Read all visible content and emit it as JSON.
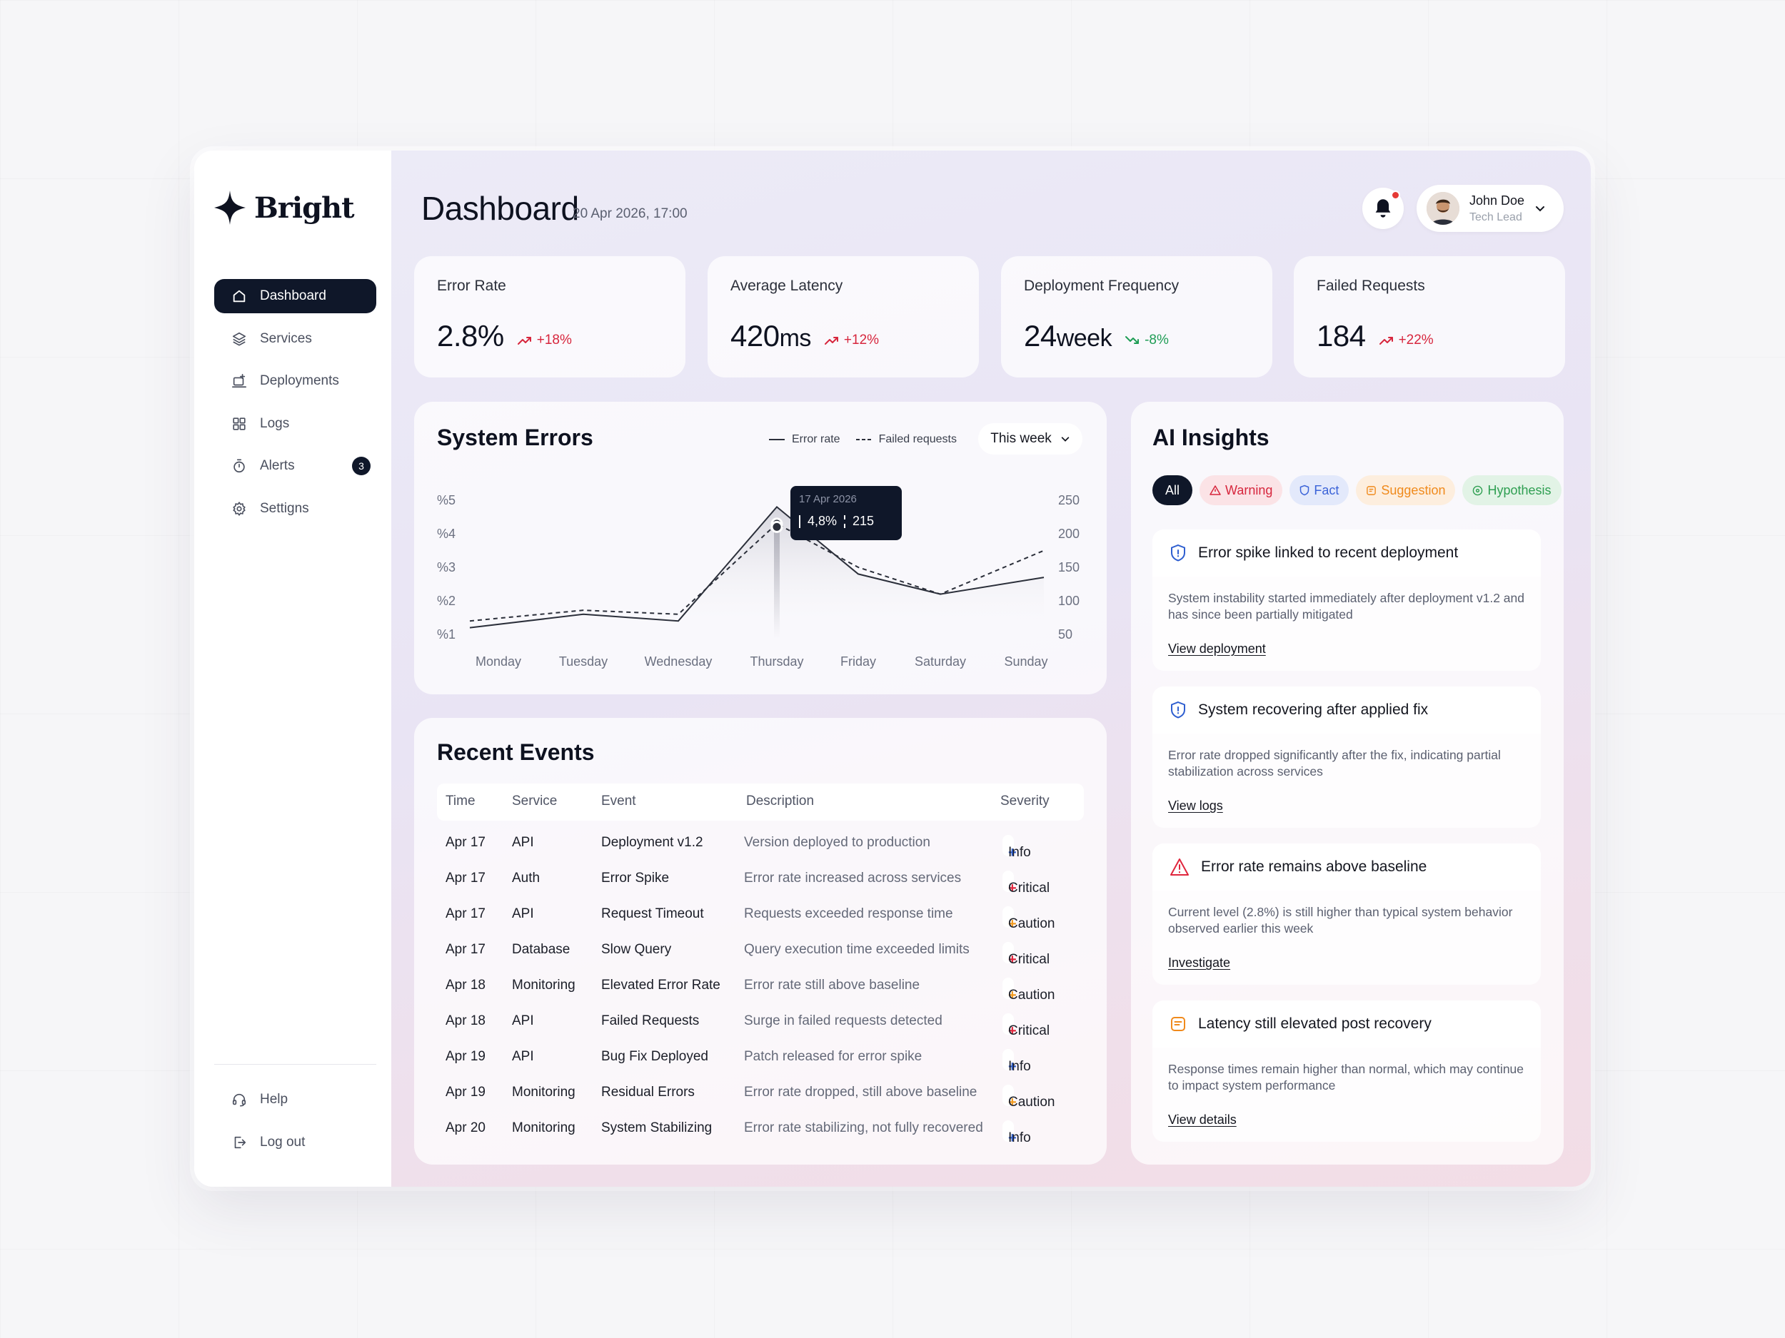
{
  "brand": {
    "name": "Bright"
  },
  "sidebar": {
    "items": [
      {
        "label": "Dashboard",
        "icon": "home-icon",
        "active": true
      },
      {
        "label": "Services",
        "icon": "layers-icon"
      },
      {
        "label": "Deployments",
        "icon": "deploy-icon"
      },
      {
        "label": "Logs",
        "icon": "grid-icon"
      },
      {
        "label": "Alerts",
        "icon": "timer-icon",
        "badge": "3"
      },
      {
        "label": "Settigns",
        "icon": "gear-icon"
      }
    ],
    "bottom": [
      {
        "label": "Help",
        "icon": "headset-icon"
      },
      {
        "label": "Log out",
        "icon": "logout-icon"
      }
    ]
  },
  "header": {
    "title": "Dashboard",
    "date": "20 Apr 2026, 17:00",
    "user": {
      "name": "John Doe",
      "role": "Tech Lead"
    }
  },
  "kpis": [
    {
      "label": "Error Rate",
      "value": "2.8%",
      "unit": "",
      "delta": "+18%",
      "trend": "up"
    },
    {
      "label": "Average Latency",
      "value": "420",
      "unit": "ms",
      "delta": "+12%",
      "trend": "up"
    },
    {
      "label": "Deployment Frequency",
      "value": "24",
      "unit": "week",
      "delta": "-8%",
      "trend": "down"
    },
    {
      "label": "Failed Requests",
      "value": "184",
      "unit": "",
      "delta": "+22%",
      "trend": "up"
    }
  ],
  "system_errors": {
    "title": "System Errors",
    "legend": [
      "Error rate",
      "Failed requests"
    ],
    "range_select": "This week",
    "tooltip": {
      "date": "17 Apr 2026",
      "rate": "4,8%",
      "requests": "215"
    }
  },
  "chart_data": {
    "type": "line",
    "categories": [
      "Monday",
      "Tuesday",
      "Wednesday",
      "Thursday",
      "Friday",
      "Saturday",
      "Sunday"
    ],
    "series": [
      {
        "name": "Error rate",
        "axis": "left",
        "style": "solid",
        "values": [
          1.2,
          1.6,
          1.4,
          4.8,
          2.8,
          2.2,
          2.7
        ]
      },
      {
        "name": "Failed requests",
        "axis": "right",
        "style": "dashed",
        "values": [
          70,
          86,
          80,
          215,
          150,
          110,
          175
        ]
      }
    ],
    "y_left": {
      "ticks": [
        "%5",
        "%4",
        "%3",
        "%2",
        "%1"
      ],
      "range": [
        1,
        5
      ]
    },
    "y_right": {
      "ticks": [
        "250",
        "200",
        "150",
        "100",
        "50"
      ],
      "range": [
        50,
        250
      ]
    },
    "highlight_index": 3
  },
  "events": {
    "title": "Recent Events",
    "columns": [
      "Time",
      "Service",
      "Event",
      "Description",
      "Severity"
    ],
    "rows": [
      [
        "Apr 17",
        "API",
        "Deployment v1.2",
        "Version deployed to production",
        "Info"
      ],
      [
        "Apr 17",
        "Auth",
        "Error Spike",
        "Error rate increased across services",
        "Critical"
      ],
      [
        "Apr 17",
        "API",
        "Request Timeout",
        "Requests exceeded response time",
        "Caution"
      ],
      [
        "Apr 17",
        "Database",
        "Slow Query",
        "Query execution time exceeded limits",
        "Critical"
      ],
      [
        "Apr 18",
        "Monitoring",
        "Elevated Error Rate",
        "Error rate still above baseline",
        "Caution"
      ],
      [
        "Apr 18",
        "API",
        "Failed Requests",
        "Surge in failed requests detected",
        "Critical"
      ],
      [
        "Apr 19",
        "API",
        "Bug Fix Deployed",
        "Patch released for error spike",
        "Info"
      ],
      [
        "Apr 19",
        "Monitoring",
        "Residual Errors",
        "Error rate dropped, still above baseline",
        "Caution"
      ],
      [
        "Apr 20",
        "Monitoring",
        "System Stabilizing",
        "Error rate stabilizing, not fully recovered",
        "Info"
      ]
    ],
    "severity_colors": {
      "Info": "#2f5fd0",
      "Critical": "#e0263d",
      "Caution": "#f29a1f"
    }
  },
  "insights": {
    "title": "AI Insights",
    "filters": [
      "All",
      "Warning",
      "Fact",
      "Suggestion",
      "Hypothesis"
    ],
    "items": [
      {
        "type": "fact",
        "icon": "shield-icon",
        "title": "Error spike linked to recent deployment",
        "body": "System instability started immediately after deployment v1.2 and has since been partially mitigated",
        "link": "View deployment"
      },
      {
        "type": "fact",
        "icon": "shield-icon",
        "title": "System recovering after applied fix",
        "body": "Error rate dropped significantly after the fix, indicating partial stabilization across services",
        "link": "View logs"
      },
      {
        "type": "warning",
        "icon": "warning-icon",
        "title": "Error rate remains above baseline",
        "body": "Current level (2.8%) is still higher than typical system behavior observed earlier this week",
        "link": "Investigate"
      },
      {
        "type": "suggestion",
        "icon": "note-icon",
        "title": "Latency still elevated post recovery",
        "body": "Response times remain higher than normal, which may continue to impact system performance",
        "link": "View details"
      }
    ]
  },
  "colors": {
    "accent_dark": "#0f1729",
    "up": "#d7263d",
    "down": "#1f9d55",
    "bell_dot": "#e53935"
  }
}
